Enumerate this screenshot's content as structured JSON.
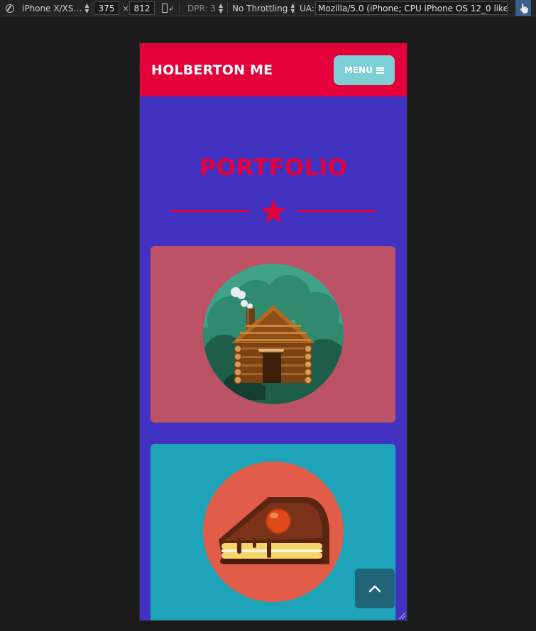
{
  "devtools": {
    "device_name": "iPhone X/XS…",
    "width": "375",
    "times": "×",
    "height": "812",
    "dpr": "DPR: 3",
    "throttling": "No Throttling",
    "ua_label": "UA:",
    "ua_value": "Mozilla/5.0 (iPhone; CPU iPhone OS 12_0 like Mac"
  },
  "header": {
    "logo": "HOLBERTON ME",
    "menu_label": "MENU"
  },
  "section": {
    "title": "PORTFOLIO"
  },
  "colors": {
    "header_bg": "#e4003b",
    "page_bg": "#4232c1",
    "menu_bg": "#7ccfd4",
    "card1_bg": "#bb5266",
    "card2_bg": "#1fa3b8",
    "accent": "#e4003b"
  },
  "icons": {
    "star": "star-icon",
    "hamburger": "hamburger-icon",
    "scroll_top": "chevron-up-icon",
    "card1_image": "log-cabin-illustration",
    "card2_image": "cake-slice-illustration"
  }
}
